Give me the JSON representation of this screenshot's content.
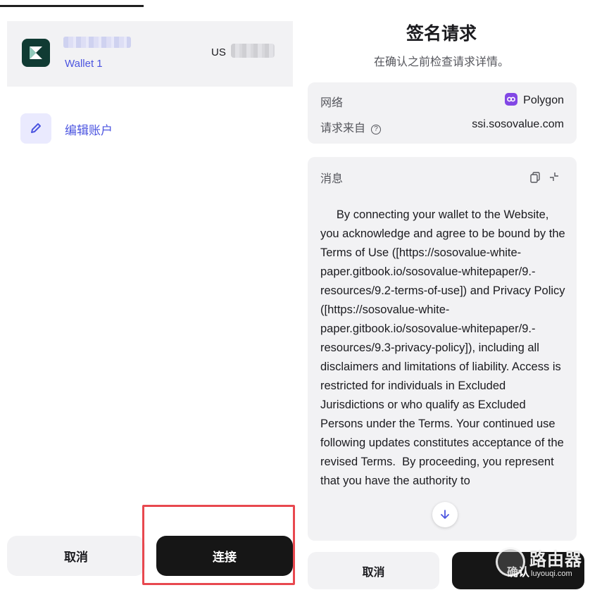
{
  "left_panel": {
    "account": {
      "wallet_label": "Wallet 1",
      "balance_prefix": "US"
    },
    "edit_account_label": "编辑账户",
    "cancel_label": "取消",
    "connect_label": "连接"
  },
  "right_panel": {
    "title": "签名请求",
    "subtitle": "在确认之前检查请求详情。",
    "network_label": "网络",
    "network_value": "Polygon",
    "request_from_label": "请求来自",
    "request_from_value": "ssi.sosovalue.com",
    "message_label": "消息",
    "message_text": "     By connecting your wallet to the Website, you acknowledge and agree to be bound by the Terms of Use ([https://sosovalue-white-paper.gitbook.io/sosovalue-whitepaper/9.-resources/9.2-terms-of-use]) and Privacy Policy ([https://sosovalue-white-paper.gitbook.io/sosovalue-whitepaper/9.-resources/9.3-privacy-policy]), including all disclaimers and limitations of liability. Access is restricted for individuals in Excluded Jurisdictions or who qualify as Excluded Persons under the Terms. Your continued use following updates constitutes acceptance of the revised Terms.  By proceeding, you represent that you have the authority to",
    "cancel_label": "取消",
    "confirm_label": "确认"
  },
  "watermark": {
    "title": "路由器",
    "url": "luyouqi.com"
  },
  "colors": {
    "accent": "#4c55e0",
    "polygon": "#8247e5",
    "highlight": "#e8484f",
    "dark_button": "#161616"
  },
  "icons": [
    "wallet-logo-icon",
    "pencil-icon",
    "polygon-icon",
    "help-icon",
    "copy-icon",
    "collapse-icon",
    "arrow-down-icon"
  ]
}
